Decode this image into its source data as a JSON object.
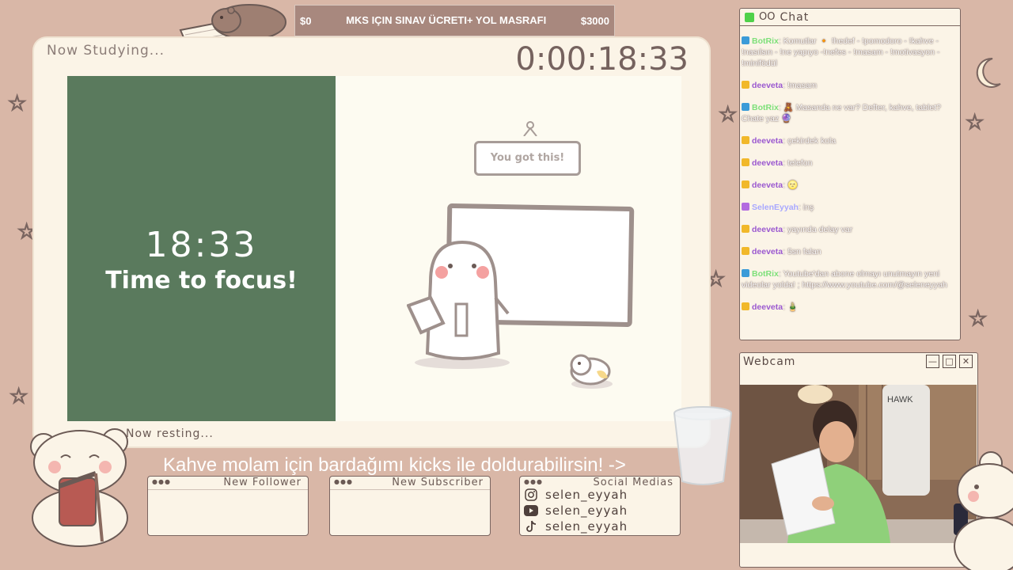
{
  "goal": {
    "start": "$0",
    "title": "MKS IÇIN SINAV ÜCRETI+ YOL MASRAFI",
    "end": "$3000"
  },
  "main": {
    "studying_label": "Now Studying...",
    "clock": "0:00:18:33",
    "focus_time": "18:33",
    "focus_message": "Time to focus!",
    "sign_text": "You got this!",
    "resting_label": "Now resting..."
  },
  "ticker": "Kahve molam için bardağımı kicks ile doldurabilirsin! ->",
  "alerts": {
    "follower": {
      "title": "New Follower",
      "content": ""
    },
    "subscriber": {
      "title": "New Subscriber",
      "content": ""
    },
    "social": {
      "title": "Social Medias",
      "items": [
        {
          "icon": "instagram-icon",
          "handle": "selen_eyyah"
        },
        {
          "icon": "youtube-icon",
          "handle": "selen_eyyah"
        },
        {
          "icon": "tiktok-icon",
          "handle": "selen_eyyah"
        }
      ]
    }
  },
  "chat": {
    "title": "Chat",
    "messages": [
      {
        "user": "BotRix",
        "color": "#7ee07a",
        "badge": "#3b9bd8",
        "text": ": Komutlar 🔸 !hedef - !pomodoro - !kahve - !nasılsın - !ne yapıyo -!nefes - !masam - !motivasyon - !minifödül"
      },
      {
        "user": "deeveta",
        "color": "#9b59d0",
        "badge": "#f1b82a",
        "text": ": !masam"
      },
      {
        "user": "BotRix",
        "color": "#7ee07a",
        "badge": "#3b9bd8",
        "text": ": 🧸 Masanda ne var? Defter, kahve, tablet? Chate yaz 🔮"
      },
      {
        "user": "deeveta",
        "color": "#9b59d0",
        "badge": "#f1b82a",
        "text": ": çekirdek kola"
      },
      {
        "user": "deeveta",
        "color": "#9b59d0",
        "badge": "#f1b82a",
        "text": ": telefon"
      },
      {
        "user": "deeveta",
        "color": "#9b59d0",
        "badge": "#f1b82a",
        "text": ": 🌝"
      },
      {
        "user": "SelenEyyah",
        "color": "#a8a8ff",
        "badge": "#b36be0",
        "text": ": inş"
      },
      {
        "user": "deeveta",
        "color": "#9b59d0",
        "badge": "#f1b82a",
        "text": ": yayında delay var"
      },
      {
        "user": "deeveta",
        "color": "#9b59d0",
        "badge": "#f1b82a",
        "text": ": 5sn falan"
      },
      {
        "user": "BotRix",
        "color": "#7ee07a",
        "badge": "#3b9bd8",
        "text": ": Youtube'dan abone olmayı unutmayın yeni videolar yolda! ; https://www.youtube.com/@seleneyyah"
      },
      {
        "user": "deeveta",
        "color": "#9b59d0",
        "badge": "#f1b82a",
        "text": ": 🎍"
      }
    ]
  },
  "webcam": {
    "title": "Webcam",
    "chair_label": "HAWK"
  }
}
